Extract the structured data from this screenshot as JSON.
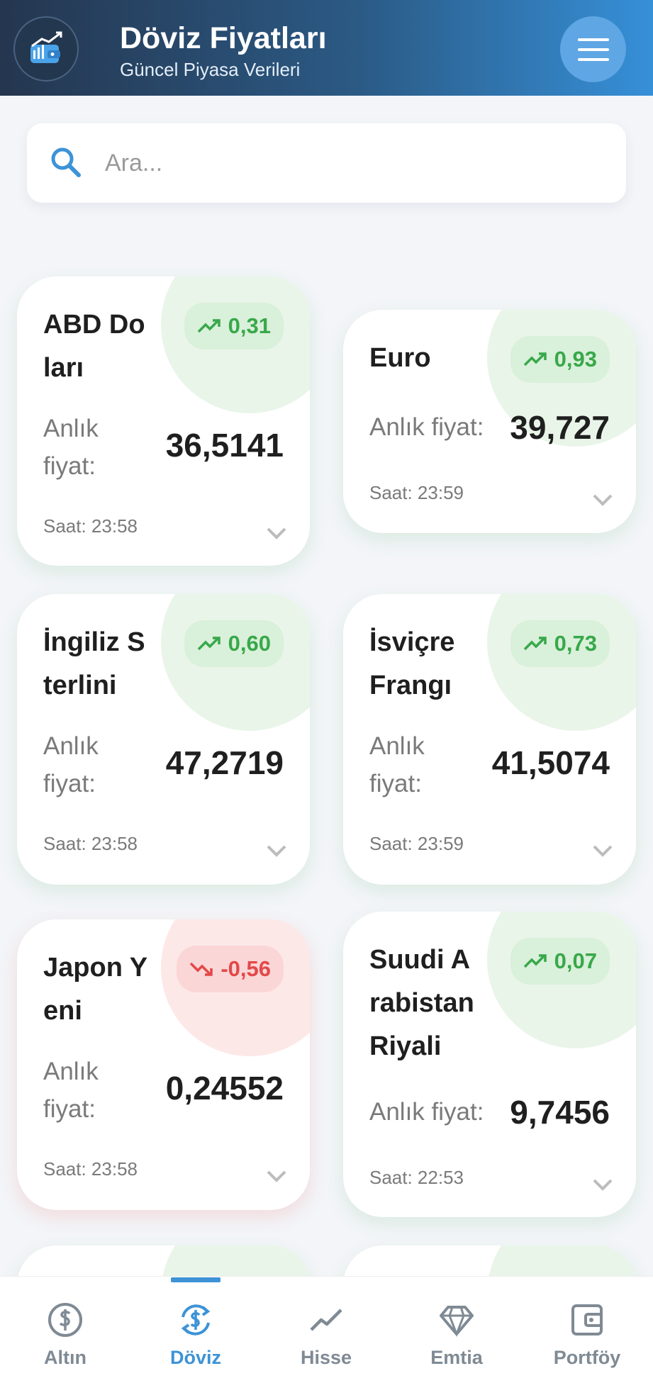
{
  "header": {
    "title": "Döviz Fiyatları",
    "subtitle": "Güncel Piyasa Verileri",
    "logo_icon": "wallet-chart-icon",
    "menu_icon": "hamburger-menu-icon"
  },
  "search": {
    "placeholder": "Ara..."
  },
  "price_label": "Anlık fiyat:",
  "cards": [
    {
      "name": "ABD Doları",
      "change": "0,31",
      "trend": "up",
      "price": "36,5141",
      "time": "Saat: 23:58"
    },
    {
      "name": "Euro",
      "change": "0,93",
      "trend": "up",
      "price": "39,727",
      "time": "Saat: 23:59"
    },
    {
      "name": "İngiliz Sterlini",
      "change": "0,60",
      "trend": "up",
      "price": "47,2719",
      "time": "Saat: 23:58"
    },
    {
      "name": "İsviçre Frangı",
      "change": "0,73",
      "trend": "up",
      "price": "41,5074",
      "time": "Saat: 23:59"
    },
    {
      "name": "Japon Yeni",
      "change": "-0,56",
      "trend": "down",
      "price": "0,24552",
      "time": "Saat: 23:58"
    },
    {
      "name": "Suudi Arabistan Riyali",
      "change": "0,07",
      "trend": "up",
      "price": "9,7456",
      "time": "Saat: 22:53"
    }
  ],
  "nav": [
    {
      "label": "Altın",
      "icon": "dollar-coin-icon",
      "active": false
    },
    {
      "label": "Döviz",
      "icon": "currency-exchange-icon",
      "active": true
    },
    {
      "label": "Hisse",
      "icon": "trending-line-icon",
      "active": false
    },
    {
      "label": "Emtia",
      "icon": "diamond-icon",
      "active": false
    },
    {
      "label": "Portföy",
      "icon": "wallet-icon",
      "active": false
    }
  ],
  "colors": {
    "accent": "#3d93d6",
    "positive": "#38a84a",
    "negative": "#e34848",
    "header_start": "#25364f",
    "header_end": "#3690d8"
  }
}
